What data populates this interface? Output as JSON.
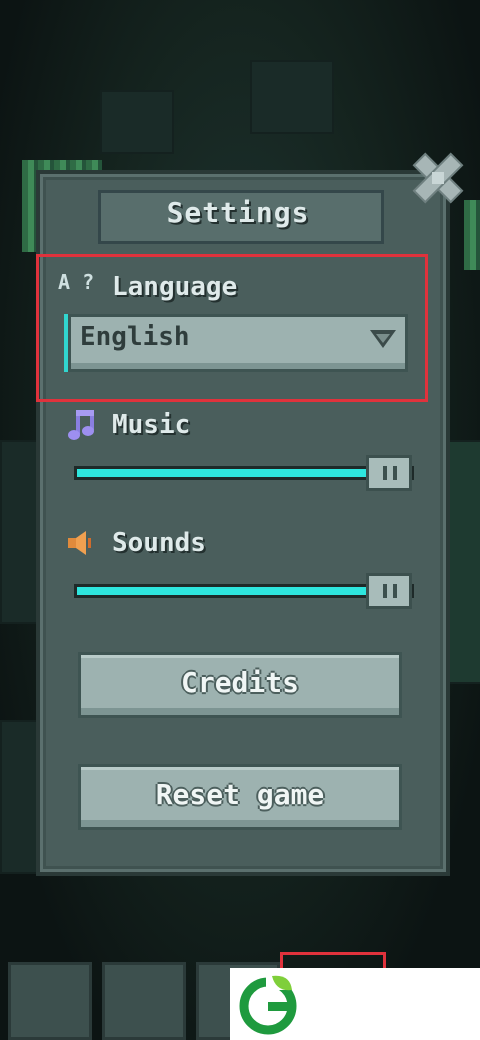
{
  "settings": {
    "title": "Settings",
    "language_label": "Language",
    "language_icon": "A ?",
    "language_value": "English",
    "music_label": "Music",
    "music_level": 0.95,
    "sounds_label": "Sounds",
    "sounds_level": 0.95,
    "credits_button": "Credits",
    "reset_button": "Reset game"
  },
  "icons": {
    "close": "close-icon",
    "language": "translate-icon",
    "dropdown": "chevron-down-icon",
    "music": "music-note-icon",
    "sounds": "speaker-icon"
  },
  "colors": {
    "accent": "#2ee6de",
    "highlight": "#e0323c",
    "panel": "#4a5e5c",
    "button": "#9db2b0"
  }
}
